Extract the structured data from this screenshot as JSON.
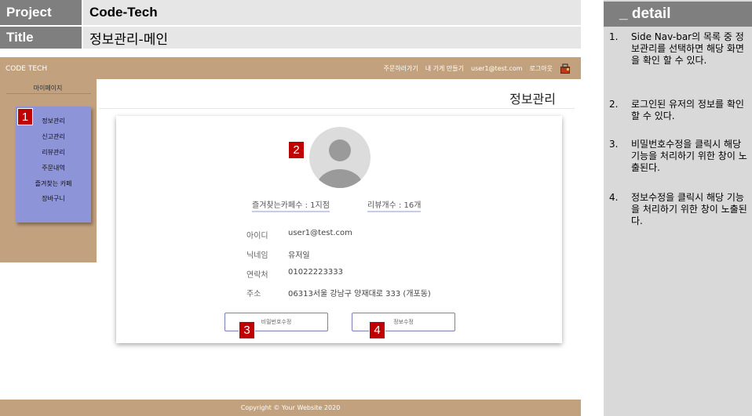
{
  "header": {
    "project_label": "Project",
    "project_value": "Code-Tech",
    "title_label": "Title",
    "title_value": "정보관리-메인"
  },
  "mockup": {
    "brand": "CODE TECH",
    "nav_links": [
      "주문하러가기",
      "내 가게 만들기",
      "user1@test.com",
      "로그아웃"
    ],
    "sidebar": {
      "title": "마이페이지",
      "items": [
        "정보관리",
        "신고관리",
        "리뷰관리",
        "주문내역",
        "즐겨찾는 카페",
        "장바구니"
      ]
    },
    "page_title": "정보관리",
    "stats": {
      "favorites": "즐겨찾는카페수 : 1지점",
      "reviews": "리뷰개수 : 16개"
    },
    "profile": [
      {
        "label": "아이디",
        "value": "user1@test.com"
      },
      {
        "label": "닉네임",
        "value": "유저일"
      },
      {
        "label": "연락처",
        "value": "01022223333"
      },
      {
        "label": "주소",
        "value": "06313서울 강남구 양재대로 333 (개포동)"
      }
    ],
    "buttons": {
      "password_change": "비밀번호수정",
      "info_change": "정보수정"
    },
    "footer": "Copyright © Your Website 2020",
    "markers": [
      "1",
      "2",
      "3",
      "4"
    ]
  },
  "detail": {
    "heading": "_ detail",
    "items": [
      {
        "num": "1.",
        "text": "Side Nav-bar의 목록 중 정보관리를 선택하면 해당 화면을 확인 할 수 있다."
      },
      {
        "num": "2.",
        "text": "로그인된 유저의 정보를 확인 할 수 있다."
      },
      {
        "num": "3.",
        "text": "비밀번호수정을 클릭시 해당 기능을 처리하기 위한 창이 노출된다."
      },
      {
        "num": "4.",
        "text": "정보수정을 클릭시 해당 기능을 처리하기 위한 창이 노출된다."
      }
    ]
  },
  "colors": {
    "brand_tan": "#c2a17e",
    "sidebar_menu": "#8d94d8",
    "marker_red": "#c00000",
    "header_gray": "#7f7f7f"
  }
}
